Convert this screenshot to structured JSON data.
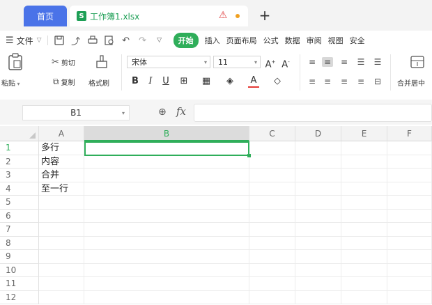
{
  "tabs": {
    "home_label": "首页",
    "doc_icon_letter": "S",
    "doc_label": "工作簿1.xlsx",
    "new_tab_icon": "plus-icon"
  },
  "menu": {
    "file_label": "文件",
    "start_label": "开始",
    "items": [
      "插入",
      "页面布局",
      "公式",
      "数据",
      "审阅",
      "视图",
      "安全"
    ]
  },
  "ribbon": {
    "paste_label": "粘贴",
    "cut_label": "剪切",
    "copy_label": "复制",
    "format_painter_label": "格式刷",
    "font_name": "宋体",
    "font_size": "11",
    "merge_label": "合并居中"
  },
  "formula_bar": {
    "cell_ref": "B1",
    "fx_label": "fx"
  },
  "grid": {
    "columns": [
      "A",
      "B",
      "C",
      "D",
      "E",
      "F"
    ],
    "selected_column": "B",
    "rows": [
      "1",
      "2",
      "3",
      "4",
      "5",
      "6",
      "7",
      "8",
      "9",
      "10",
      "11",
      "12"
    ],
    "cells_a": [
      "多行",
      "内容",
      "合并",
      "至一行"
    ]
  },
  "colors": {
    "accent_green": "#2fae5a",
    "tab_blue": "#4a73e8"
  }
}
